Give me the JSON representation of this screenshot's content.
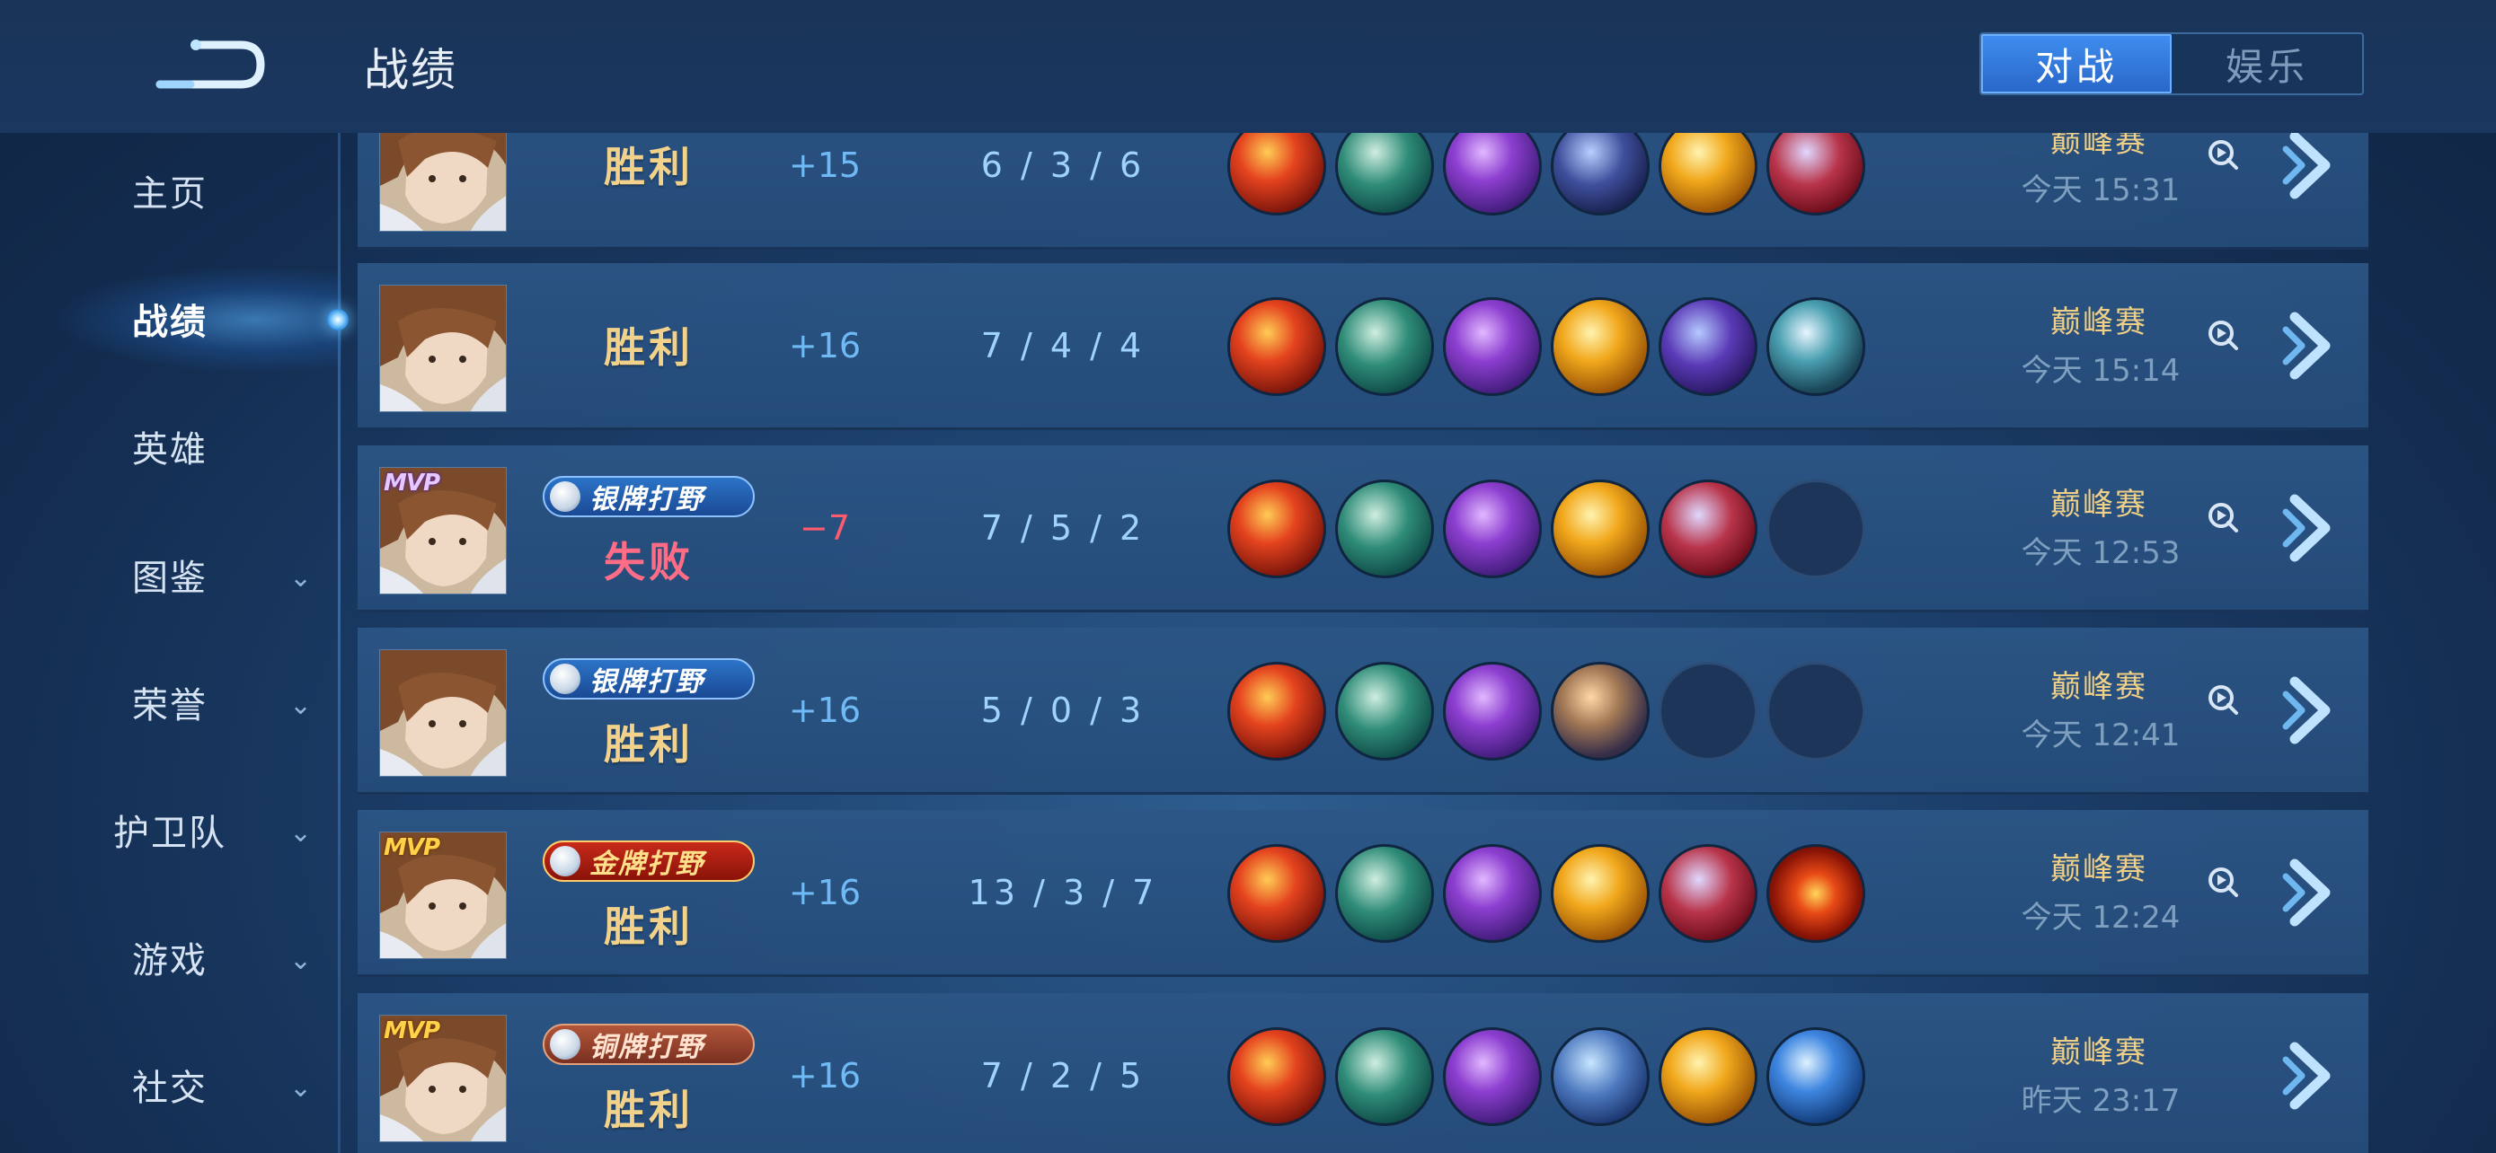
{
  "header": {
    "title": "战绩",
    "tabs": [
      {
        "label": "对战",
        "active": true
      },
      {
        "label": "娱乐",
        "active": false
      }
    ]
  },
  "sidebar": {
    "items": [
      {
        "label": "主页",
        "active": false,
        "expandable": false
      },
      {
        "label": "战绩",
        "active": true,
        "expandable": false
      },
      {
        "label": "英雄",
        "active": false,
        "expandable": false
      },
      {
        "label": "图鉴",
        "active": false,
        "expandable": true
      },
      {
        "label": "荣誉",
        "active": false,
        "expandable": true
      },
      {
        "label": "护卫队",
        "active": false,
        "expandable": true
      },
      {
        "label": "游戏",
        "active": false,
        "expandable": true
      },
      {
        "label": "社交",
        "active": false,
        "expandable": true
      }
    ]
  },
  "matches": [
    {
      "mvp": "",
      "badge": "",
      "result": "胜利",
      "outcome": "win",
      "points": "+15",
      "kda": "6 / 3 / 6",
      "items": [
        "red",
        "boot",
        "purple",
        "navy",
        "gold",
        "crimson"
      ],
      "mode": "巅峰赛",
      "time": "今天 15:31",
      "replay": true
    },
    {
      "mvp": "",
      "badge": "",
      "result": "胜利",
      "outcome": "win",
      "points": "+16",
      "kda": "7 / 4 / 4",
      "items": [
        "red",
        "boot",
        "purple",
        "gold",
        "violet",
        "teal"
      ],
      "mode": "巅峰赛",
      "time": "今天 15:14",
      "replay": true
    },
    {
      "mvp": "MVP",
      "mvp_style": "purple",
      "badge": "银牌打野",
      "badge_style": "silver",
      "result": "失败",
      "outcome": "lose",
      "points": "−7",
      "kda": "7 / 5 / 2",
      "items": [
        "red",
        "boot",
        "purple",
        "gold",
        "crimson",
        "empty"
      ],
      "mode": "巅峰赛",
      "time": "今天 12:53",
      "replay": true
    },
    {
      "mvp": "",
      "badge": "银牌打野",
      "badge_style": "silver",
      "result": "胜利",
      "outcome": "win",
      "points": "+16",
      "kda": "5 / 0 / 3",
      "items": [
        "red",
        "boot",
        "purple",
        "armor",
        "empty",
        "empty"
      ],
      "mode": "巅峰赛",
      "time": "今天 12:41",
      "replay": true
    },
    {
      "mvp": "MVP",
      "mvp_style": "gold",
      "badge": "金牌打野",
      "badge_style": "gold",
      "result": "胜利",
      "outcome": "win",
      "points": "+16",
      "kda": "13 / 3 / 7",
      "items": [
        "red",
        "boot",
        "purple",
        "gold",
        "crimson",
        "fire"
      ],
      "mode": "巅峰赛",
      "time": "今天 12:24",
      "replay": true
    },
    {
      "mvp": "MVP",
      "mvp_style": "gold",
      "badge": "铜牌打野",
      "badge_style": "bronze",
      "result": "胜利",
      "outcome": "win",
      "points": "+16",
      "kda": "7 / 2 / 5",
      "items": [
        "red",
        "boot",
        "purple",
        "sky",
        "gold",
        "blue"
      ],
      "mode": "巅峰赛",
      "time": "昨天 23:17",
      "replay": false
    }
  ],
  "colors": {
    "accent": "#3f8ef0",
    "win_text": "#f2d28a",
    "lose_text": "#ff6c86",
    "points_positive": "#6fbaf5",
    "points_negative": "#ff5b6e",
    "mode_text": "#f0cf86"
  }
}
